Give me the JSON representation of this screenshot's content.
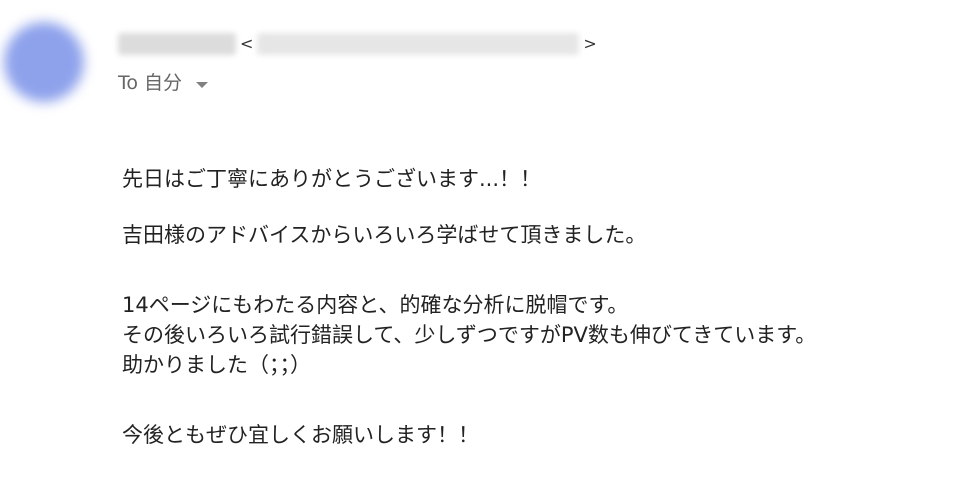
{
  "header": {
    "bracket_open": "<",
    "bracket_close": ">",
    "to_label": "To 自分"
  },
  "body": {
    "lines": [
      "先日はご丁寧にありがとうございます...！！",
      "吉田様のアドバイスからいろいろ学ばせて頂きました。",
      "14ページにもわたる内容と、的確な分析に脱帽です。",
      "その後いろいろ試行錯誤して、少しずつですがPV数も伸びてきています。",
      "助かりました（；；）",
      "今後ともぜひ宜しくお願いします！！"
    ]
  },
  "icons": {
    "recipient_dropdown": "chevron-down-icon"
  }
}
